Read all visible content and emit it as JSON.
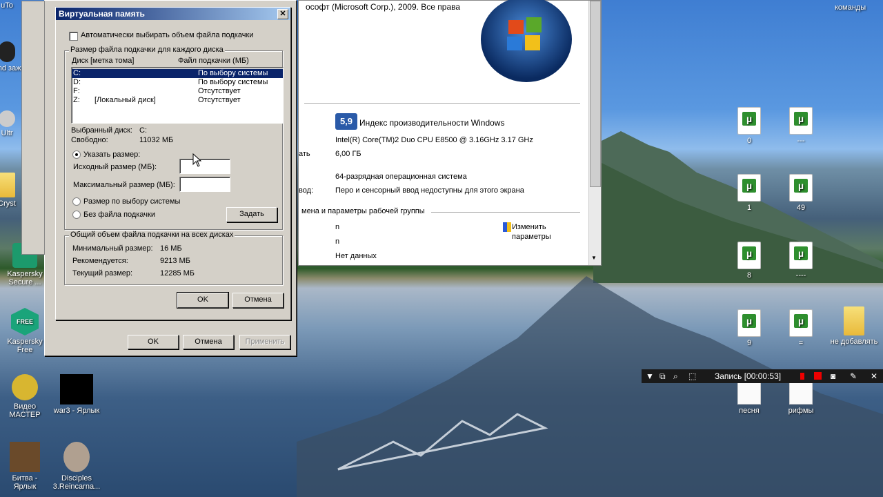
{
  "desktop": {
    "top_right_label": "команды",
    "left_icons": [
      {
        "label": "uTo",
        "top": true
      },
      {
        "label": "Band зажа"
      },
      {
        "label": "Ultr"
      },
      {
        "label": "Cryst"
      },
      {
        "label": "Kaspersky Secure ..."
      },
      {
        "label": "Kaspersky Free"
      },
      {
        "label": "Видео МАСТЕР"
      },
      {
        "label": "war3 - Ярлык"
      },
      {
        "label": "Битва - Ярлык"
      },
      {
        "label": "Disciples 3.Reincarna..."
      }
    ],
    "right_icons": [
      {
        "label": "0"
      },
      {
        "label": "---"
      },
      {
        "label": "1"
      },
      {
        "label": "49"
      },
      {
        "label": "8"
      },
      {
        "label": "----"
      },
      {
        "label": "9"
      },
      {
        "label": "="
      },
      {
        "label": "не добавлять"
      },
      {
        "label": "песня"
      },
      {
        "label": "рифмы"
      }
    ]
  },
  "system_window": {
    "copyright": "ософт (Microsoft Corp.), 2009. Все права",
    "rating_score": "5,9",
    "rating_label": "Индекс производительности Windows",
    "cpu": "Intel(R) Core(TM)2 Duo CPU     E8500  @ 3.16GHz   3.17 GHz",
    "ram_label": "ать",
    "ram": "6,00 ГБ",
    "os_type": "64-разрядная операционная система",
    "pen_label": "вод:",
    "pen": "Перо и сенсорный ввод недоступны для этого экрана",
    "section_title": "мена и параметры рабочей группы",
    "row1": "n",
    "row2": "n",
    "row3": "Нет данных",
    "change_settings": "Изменить параметры"
  },
  "perf_window": {
    "ok": "OK",
    "cancel": "Отмена",
    "apply": "Применить"
  },
  "vm_dialog": {
    "title": "Виртуальная память",
    "auto_checkbox": "Автоматически выбирать объем файла подкачки",
    "group1_title": "Размер файла подкачки для каждого диска",
    "col_disk": "Диск [метка тома]",
    "col_size": "Файл подкачки (МБ)",
    "drives": [
      {
        "disk": "C:",
        "label": "",
        "size": "По выбору системы",
        "selected": true
      },
      {
        "disk": "D:",
        "label": "",
        "size": "По выбору системы",
        "selected": false
      },
      {
        "disk": "F:",
        "label": "",
        "size": "Отсутствует",
        "selected": false
      },
      {
        "disk": "Z:",
        "label": "[Локальный диск]",
        "size": "Отсутствует",
        "selected": false
      }
    ],
    "selected_disk_label": "Выбранный диск:",
    "selected_disk_value": "C:",
    "free_label": "Свободно:",
    "free_value": "11032 МБ",
    "custom_size": "Указать размер:",
    "initial_size": "Исходный размер (МБ):",
    "max_size": "Максимальный размер (МБ):",
    "system_managed": "Размер по выбору системы",
    "no_paging": "Без файла подкачки",
    "set_button": "Задать",
    "group2_title": "Общий объем файла подкачки на всех дисках",
    "min_label": "Минимальный размер:",
    "min_value": "16 МБ",
    "rec_label": "Рекомендуется:",
    "rec_value": "9213 МБ",
    "cur_label": "Текущий размер:",
    "cur_value": "12285 МБ",
    "ok": "OK",
    "cancel": "Отмена"
  },
  "recorder": {
    "label": "Запись [00:00:53]"
  }
}
